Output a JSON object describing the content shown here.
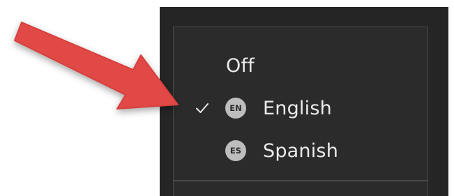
{
  "caption_menu": {
    "items": [
      {
        "label": "Off",
        "badge": "",
        "selected": false
      },
      {
        "label": "English",
        "badge": "EN",
        "selected": true
      },
      {
        "label": "Spanish",
        "badge": "ES",
        "selected": false
      }
    ],
    "check_icon": "checkmark-icon"
  },
  "colors": {
    "panel_background": "#252525",
    "menu_background": "#2b2b2b",
    "text": "#ebebeb",
    "badge_background": "#bdbdbd",
    "annotation_arrow": "#e14a47"
  }
}
